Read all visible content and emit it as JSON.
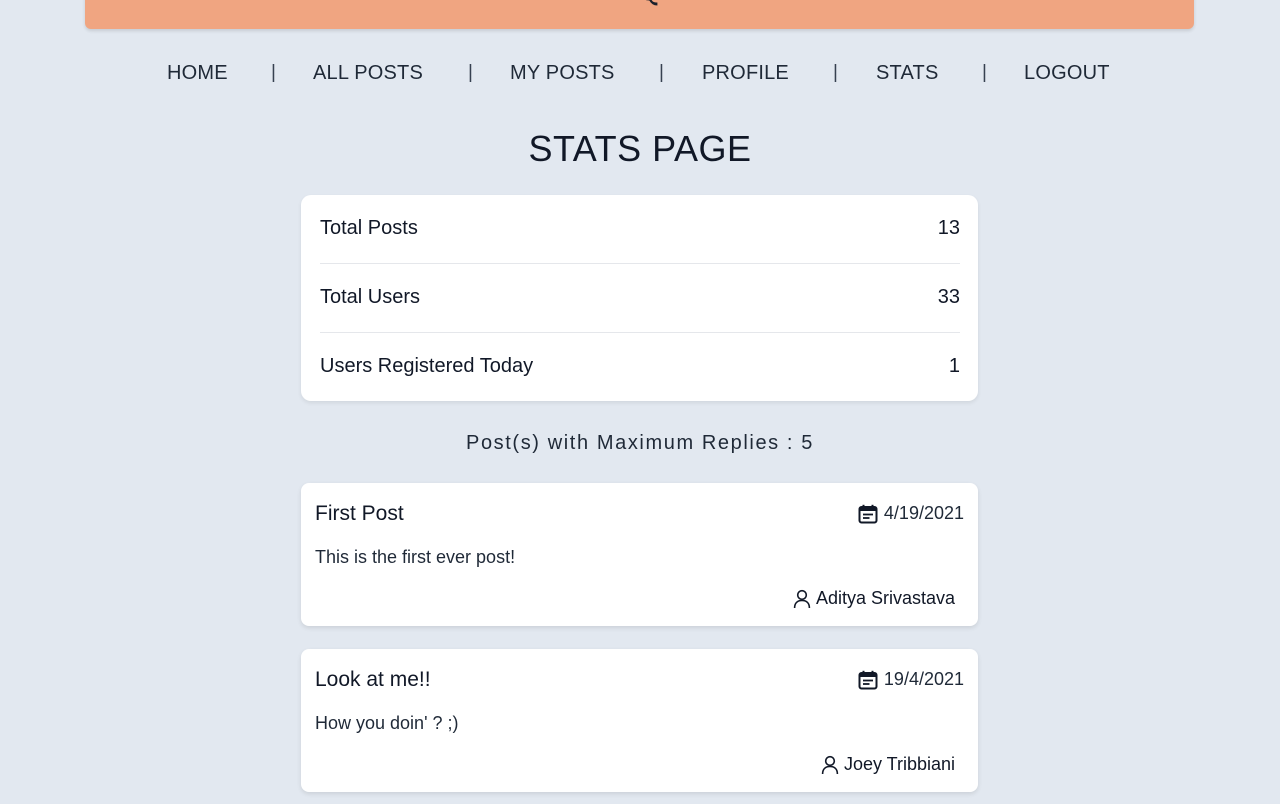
{
  "nav": {
    "items": [
      {
        "label": "HOME"
      },
      {
        "label": "ALL POSTS"
      },
      {
        "label": "MY POSTS"
      },
      {
        "label": "PROFILE"
      },
      {
        "label": "STATS"
      },
      {
        "label": "LOGOUT"
      }
    ],
    "separator": "|"
  },
  "page": {
    "title": "STATS PAGE"
  },
  "stats": {
    "rows": [
      {
        "label": "Total Posts",
        "value": "13"
      },
      {
        "label": "Total Users",
        "value": "33"
      },
      {
        "label": "Users Registered Today",
        "value": "1"
      }
    ]
  },
  "max_replies": {
    "heading": "Post(s) with Maximum Replies : 5"
  },
  "posts": [
    {
      "title": "First Post",
      "date": "4/19/2021",
      "body": "This is the first ever post!",
      "author": "Aditya Srivastava"
    },
    {
      "title": "Look at me!!",
      "date": "19/4/2021",
      "body": "How you doin' ? ;)",
      "author": "Joey Tribbiani"
    }
  ],
  "theme": {
    "background": "#e2e8f0",
    "header_accent": "#f0a581",
    "card": "#ffffff"
  },
  "icons": {
    "date": "calendar-icon",
    "author": "user-icon"
  }
}
